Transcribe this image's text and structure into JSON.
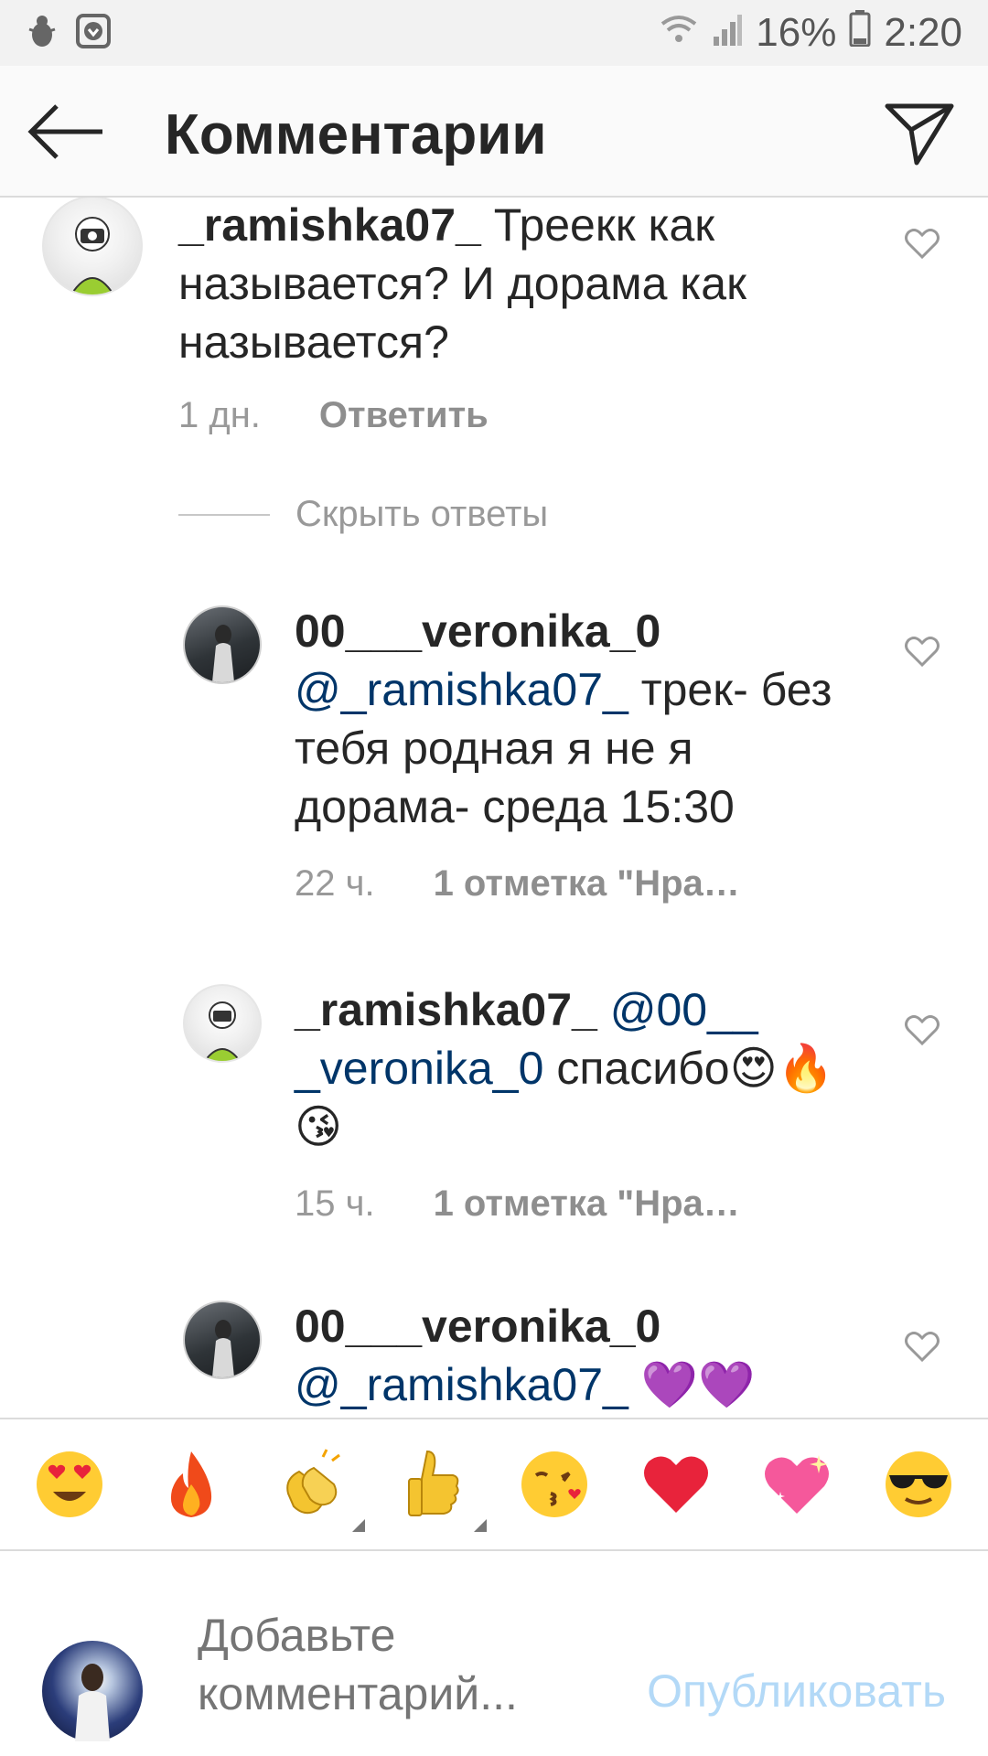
{
  "status_bar": {
    "battery": "16%",
    "time": "2:20",
    "left_icons": [
      "bug-icon",
      "download-icon"
    ],
    "right_icons": [
      "wifi-icon",
      "signal-icon",
      "battery-icon"
    ]
  },
  "header": {
    "title": "Комментарии",
    "back_icon": "back-arrow-icon",
    "share_icon": "paper-plane-icon"
  },
  "comments": [
    {
      "username": "_ramishka07_",
      "text": " Треекк как называется? И дорама как называется?",
      "time": "1 дн.",
      "action": "Ответить"
    }
  ],
  "hide_replies": "Скрыть ответы",
  "replies": [
    {
      "username": "00___veronika_0",
      "mention": "@_ramishka07_",
      "text": " трек- без тебя родная я не я дорама- среда 15:30",
      "time": "22 ч.",
      "likes": "1 отметка \"Нра…"
    },
    {
      "username": "_ramishka07_",
      "mention": "@00__ _veronika_0",
      "text": " спасибо😍🔥😘",
      "time": "15 ч.",
      "likes": "1 отметка \"Нра…"
    },
    {
      "username": "00___veronika_0",
      "mention": "@_ramishka07_",
      "text": " 💜💜",
      "time": "",
      "likes": ""
    }
  ],
  "emoji_bar": [
    "😍",
    "🔥",
    "👏",
    "👍",
    "😘",
    "❤️",
    "💖",
    "😎"
  ],
  "composer": {
    "placeholder": "Добавьте комментарий...",
    "publish_label": "Опубликовать"
  },
  "colors": {
    "mention": "#003569",
    "publish": "#b3d9f7",
    "meta": "#999999"
  }
}
